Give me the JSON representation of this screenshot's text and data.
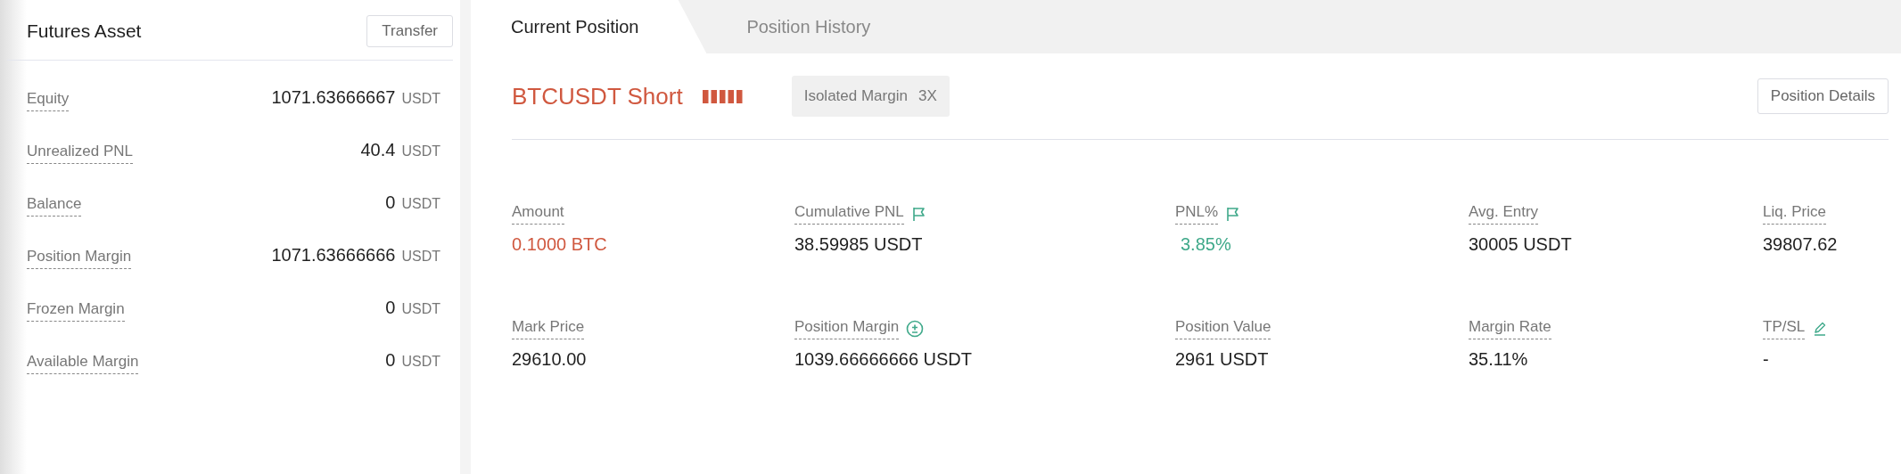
{
  "asset_panel": {
    "title": "Futures Asset",
    "button": "Transfer",
    "rows": [
      {
        "label": "Equity",
        "value": "1071.63666667",
        "unit": "USDT"
      },
      {
        "label": "Unrealized PNL",
        "value": "40.4",
        "unit": "USDT"
      },
      {
        "label": "Balance",
        "value": "0",
        "unit": "USDT"
      },
      {
        "label": "Position Margin",
        "value": "1071.63666666",
        "unit": "USDT"
      },
      {
        "label": "Frozen Margin",
        "value": "0",
        "unit": "USDT"
      },
      {
        "label": "Available Margin",
        "value": "0",
        "unit": "USDT"
      }
    ]
  },
  "tabs": [
    {
      "label": "Current Position",
      "selected": true
    },
    {
      "label": "Position History",
      "selected": false
    }
  ],
  "position": {
    "title": "BTCUSDT Short",
    "margin_mode": "Isolated Margin",
    "leverage": "3X",
    "details_button": "Position Details",
    "stats": [
      {
        "kind": "plain",
        "label": "Amount",
        "value": "0.1000 BTC",
        "color": "#d0583f"
      },
      {
        "kind": "flag",
        "label": "Cumulative PNL",
        "value": "38.59985 USDT",
        "color": "#1f1f1f"
      },
      {
        "kind": "flag",
        "label": "PNL%",
        "value": "3.85%",
        "color": "#3fa98a"
      },
      {
        "kind": "plain",
        "label": "Avg. Entry",
        "value": "30005 USDT",
        "color": "#1f1f1f"
      },
      {
        "kind": "plain",
        "label": "Liq. Price",
        "value": "39807.62",
        "color": "#1f1f1f"
      },
      {
        "kind": "plain",
        "label": "Mark Price",
        "value": "29610.00",
        "color": "#1f1f1f"
      },
      {
        "kind": "adjust",
        "label": "Position Margin",
        "value": "1039.66666666 USDT",
        "color": "#1f1f1f"
      },
      {
        "kind": "plain",
        "label": "Position Value",
        "value": "2961 USDT",
        "color": "#1f1f1f"
      },
      {
        "kind": "plain",
        "label": "Margin Rate",
        "value": "35.11%",
        "color": "#1f1f1f"
      },
      {
        "kind": "edit",
        "label": "TP/SL",
        "value": "-",
        "color": "#1f1f1f"
      }
    ]
  }
}
